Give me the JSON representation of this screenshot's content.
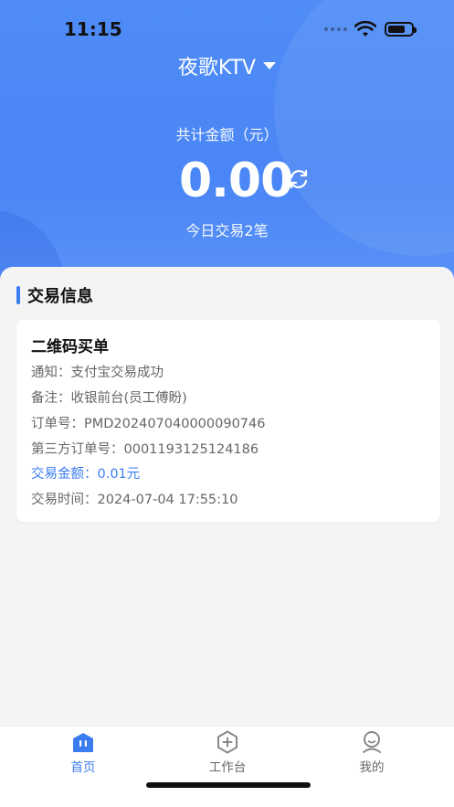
{
  "status": {
    "time": "11:15"
  },
  "header": {
    "store_name": "夜歌KTV",
    "total_label": "共计金额（元）",
    "amount": "0.00",
    "today_summary": "今日交易2笔"
  },
  "section": {
    "title": "交易信息"
  },
  "transaction": {
    "title": "二维码买单",
    "notice": "通知：支付宝交易成功",
    "remark": "备注：收银前台(员工傅盼)",
    "order_no": "订单号：PMD202407040000090746",
    "third_order_no": "第三方订单号：0001193125124186",
    "amount": "交易金额：0.01元",
    "time": "交易时间：2024-07-04 17:55:10"
  },
  "tabs": [
    {
      "label": "首页",
      "icon": "home-icon",
      "active": true
    },
    {
      "label": "工作台",
      "icon": "workbench-icon",
      "active": false
    },
    {
      "label": "我的",
      "icon": "profile-icon",
      "active": false
    }
  ],
  "colors": {
    "primary": "#3b7cf0",
    "hero": "#4a86f5",
    "background": "#f4f4f5"
  }
}
